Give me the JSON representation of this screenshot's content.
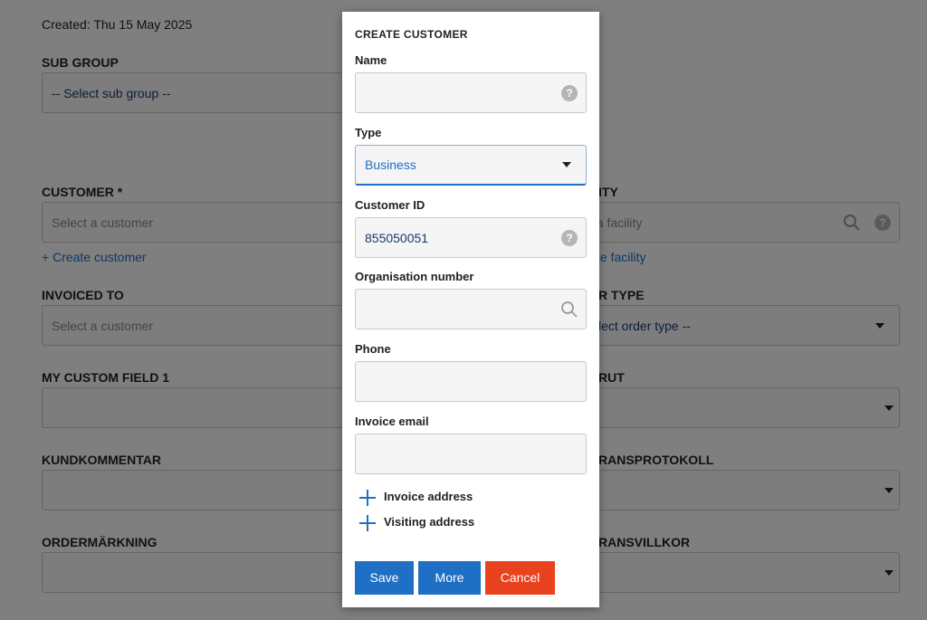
{
  "background": {
    "created": "Created: Thu 15 May 2025",
    "sub_group": {
      "label": "SUB GROUP",
      "value": "-- Select sub group --"
    },
    "customer": {
      "label": "CUSTOMER *",
      "placeholder": "Select a customer",
      "create_link": "+ Create customer"
    },
    "facility": {
      "label": "ITY",
      "placeholder": "t a facility",
      "create_link": "te facility"
    },
    "invoiced_to": {
      "label": "INVOICED TO",
      "placeholder": "Select a customer"
    },
    "order_type": {
      "label": "R TYPE",
      "value": "lect order type --"
    },
    "my_custom_field_1": {
      "label": "MY CUSTOM FIELD 1"
    },
    "rut": {
      "label": "RUT"
    },
    "kundkommentar": {
      "label": "KUNDKOMMENTAR"
    },
    "ransprotokoll": {
      "label": "RANSPROTOKOLL"
    },
    "ordermarkning": {
      "label": "ORDERMÄRKNING"
    },
    "ransvillkor": {
      "label": "RANSVILLKOR"
    }
  },
  "modal": {
    "title": "CREATE CUSTOMER",
    "fields": {
      "name": {
        "label": "Name",
        "value": ""
      },
      "type": {
        "label": "Type",
        "value": "Business"
      },
      "customer_id": {
        "label": "Customer ID",
        "value": "855050051"
      },
      "organisation_number": {
        "label": "Organisation number",
        "value": ""
      },
      "phone": {
        "label": "Phone",
        "value": ""
      },
      "invoice_email": {
        "label": "Invoice email",
        "value": ""
      }
    },
    "add_links": {
      "invoice_address": "Invoice address",
      "visiting_address": "Visiting address"
    },
    "buttons": {
      "save": "Save",
      "more": "More",
      "cancel": "Cancel"
    }
  },
  "colors": {
    "primary": "#1f6fc4",
    "danger": "#e8421e",
    "overlay": "rgba(0,0,0,0.5)"
  },
  "icons": [
    "help-icon",
    "search-icon",
    "caret-down-icon",
    "plus-icon"
  ]
}
